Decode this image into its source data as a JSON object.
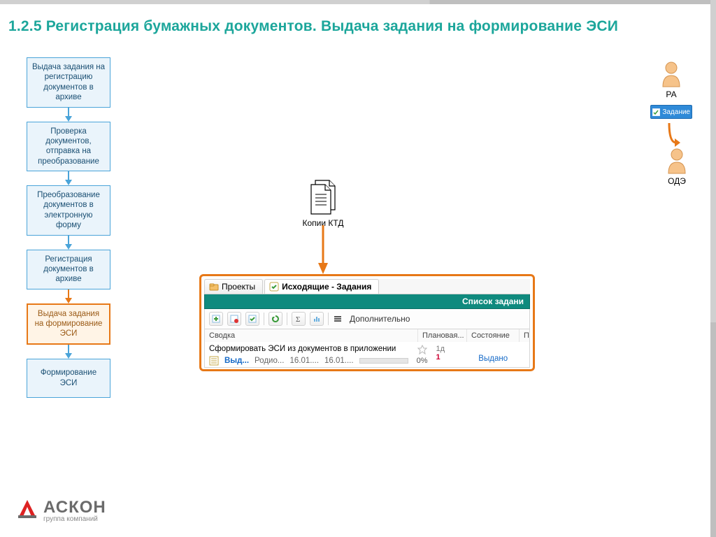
{
  "title": "1.2.5 Регистрация бумажных документов. Выдача задания на формирование ЭСИ",
  "flow": {
    "steps": [
      "Выдача задания на регистрацию документов в архиве",
      "Проверка документов, отправка на преобразование",
      "Преобразование документов в электронную форму",
      "Регистрация документов в архиве",
      "Выдача задания на формирование ЭСИ",
      "Формирование ЭСИ"
    ],
    "current_index": 4
  },
  "document_icon_label": "Копии КТД",
  "app": {
    "tabs": [
      {
        "label": "Проекты",
        "active": false
      },
      {
        "label": "Исходящие - Задания",
        "active": true
      }
    ],
    "banner": "Список задани",
    "toolbar_extra": "Дополнительно",
    "columns": {
      "c1": "Сводка",
      "c2": "Плановая...",
      "c3": "Состояние",
      "c4": "П"
    },
    "row": {
      "summary_title": "Сформировать ЭСИ из документов в приложении",
      "sub_link": "Выд...",
      "sub_author": "Родио...",
      "sub_d1": "16.01....",
      "sub_d2": "16.01....",
      "progress_pct": "0%",
      "plan_d1": "1д",
      "plan_d2": "1",
      "status": "Выдано"
    }
  },
  "actors": {
    "top": "РА",
    "chip": "Задание",
    "bottom": "ОДЭ"
  },
  "logo": {
    "name": "АСКОН",
    "tagline": "группа компаний"
  }
}
